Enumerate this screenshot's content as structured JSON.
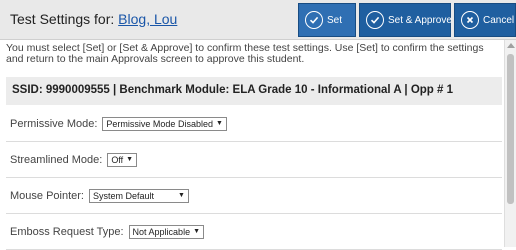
{
  "header": {
    "title_prefix": "Test Settings for: ",
    "student_link": "Blog, Lou",
    "set_label": "Set",
    "set_approve_label": "Set & Approve",
    "cancel_label": "Cancel"
  },
  "instructions": "You must select [Set] or [Set & Approve] to confirm these test settings. Use [Set] to confirm the settings and return to the main Approvals screen to approve this student.",
  "ssid_line": "SSID: 9990009555 | Benchmark Module: ELA Grade 10 - Informational A | Opp # 1",
  "settings": [
    {
      "label": "Permissive Mode:",
      "value": "Permissive Mode Disabled"
    },
    {
      "label": "Streamlined Mode:",
      "value": "Off"
    },
    {
      "label": "Mouse Pointer:",
      "value": "System Default"
    },
    {
      "label": "Emboss Request Type:",
      "value": "Not Applicable"
    }
  ],
  "colors": {
    "button_bg": "#1f5fa0",
    "link": "#1a56a8",
    "header_bg": "#e9e9e9"
  },
  "icons": {
    "set": "check-circle-icon",
    "set_approve": "check-circle-icon",
    "cancel": "x-circle-icon",
    "dropdown": "dropdown-arrow-icon"
  }
}
